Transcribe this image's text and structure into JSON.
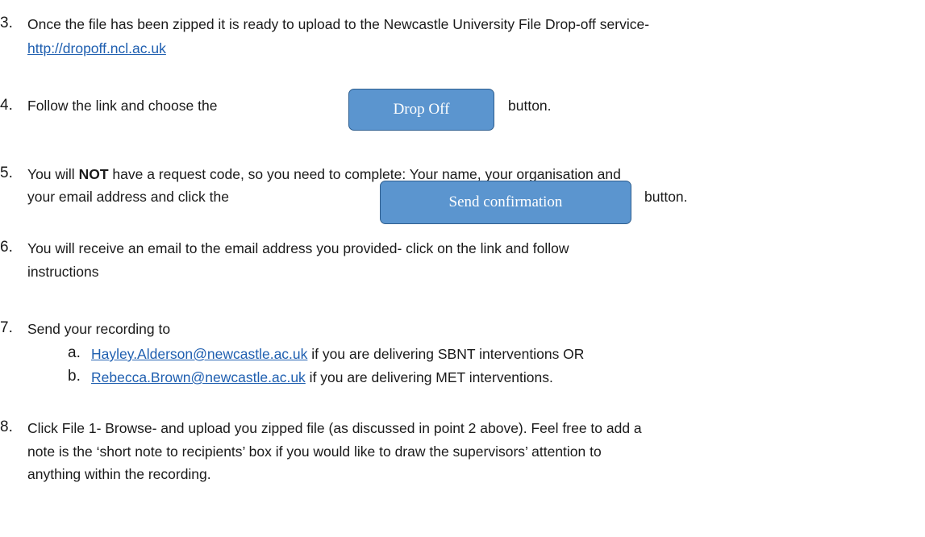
{
  "steps": {
    "s3": {
      "num": "3.",
      "text": "Once the file has been zipped it is ready to upload to the Newcastle University File Drop-off service-",
      "link": "http://dropoff.ncl.ac.uk"
    },
    "s4": {
      "num": "4.",
      "before": "Follow the link and choose the",
      "button": "Drop Off",
      "after": "button."
    },
    "s5": {
      "num": "5.",
      "pre": "You will ",
      "bold": "NOT",
      "post": " have a request code, so you need to complete: Your name, your organisation and",
      "line2": "your email address and click the",
      "button": "Send confirmation",
      "after": "button."
    },
    "s6": {
      "num": "6.",
      "line1": "You will receive an email to the email address you provided- click on the link and follow",
      "line2": "instructions"
    },
    "s7": {
      "num": "7.",
      "text": "Send your recording to",
      "a": {
        "letter": "a.",
        "link": "Hayley.Alderson@newcastle.ac.uk",
        "text": " if you are delivering SBNT interventions OR"
      },
      "b": {
        "letter": "b.",
        "link": "Rebecca.Brown@newcastle.ac.uk",
        "text": " if you are delivering MET interventions."
      }
    },
    "s8": {
      "num": "8.",
      "line1": "Click File 1- Browse- and upload you zipped file (as discussed in point 2 above). Feel free to add a",
      "line2": "note is the ‘short note to recipients’ box if you would like to draw the supervisors’ attention to",
      "line3": "anything within the recording."
    }
  }
}
